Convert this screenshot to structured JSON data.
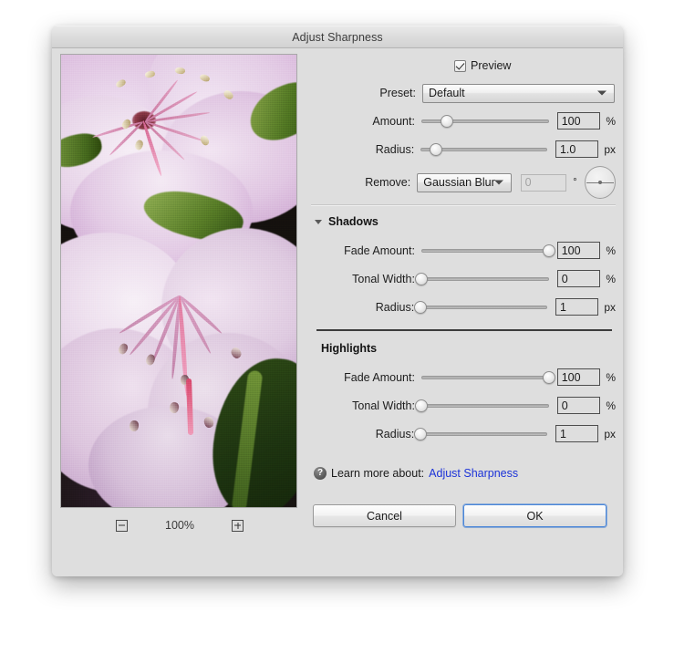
{
  "window": {
    "title": "Adjust Sharpness"
  },
  "preview": {
    "checkbox_label": "Preview",
    "checked": true,
    "zoom_level": "100%",
    "zoom_out_icon": "minus-icon",
    "zoom_in_icon": "plus-icon",
    "image_description": "Close-up photograph of a pale pink rhododendron blossom with long curving stamens"
  },
  "preset": {
    "label": "Preset:",
    "value": "Default",
    "caret_icon": "chevron-down-icon"
  },
  "main_sliders": [
    {
      "label": "Amount:",
      "value": "100",
      "unit": "%",
      "thumb_percent": 20
    },
    {
      "label": "Radius:",
      "value": "1.0",
      "unit": "px",
      "thumb_percent": 12
    }
  ],
  "remove": {
    "label": "Remove:",
    "value": "Gaussian Blur",
    "caret_icon": "chevron-down-icon",
    "angle_value": "0",
    "angle_unit": "°",
    "angle_disabled": true,
    "dial_icon": "angle-dial-icon"
  },
  "shadows": {
    "title": "Shadows",
    "expanded": true,
    "disclosure_icon": "chevron-down-icon",
    "sliders": [
      {
        "label": "Fade Amount:",
        "value": "100",
        "unit": "%",
        "thumb_percent": 100
      },
      {
        "label": "Tonal Width:",
        "value": "0",
        "unit": "%",
        "thumb_percent": 0
      },
      {
        "label": "Radius:",
        "value": "1",
        "unit": "px",
        "thumb_percent": 0
      }
    ]
  },
  "highlights": {
    "title": "Highlights",
    "sliders": [
      {
        "label": "Fade Amount:",
        "value": "100",
        "unit": "%",
        "thumb_percent": 100
      },
      {
        "label": "Tonal Width:",
        "value": "0",
        "unit": "%",
        "thumb_percent": 0
      },
      {
        "label": "Radius:",
        "value": "1",
        "unit": "px",
        "thumb_percent": 0
      }
    ]
  },
  "learn_more": {
    "help_icon": "question-mark-icon",
    "text": "Learn more about:",
    "link": "Adjust Sharpness",
    "link_color": "#1b32d8"
  },
  "buttons": {
    "cancel": "Cancel",
    "ok": "OK",
    "default_button": "OK",
    "focus_ring_color": "#4a86d8"
  }
}
